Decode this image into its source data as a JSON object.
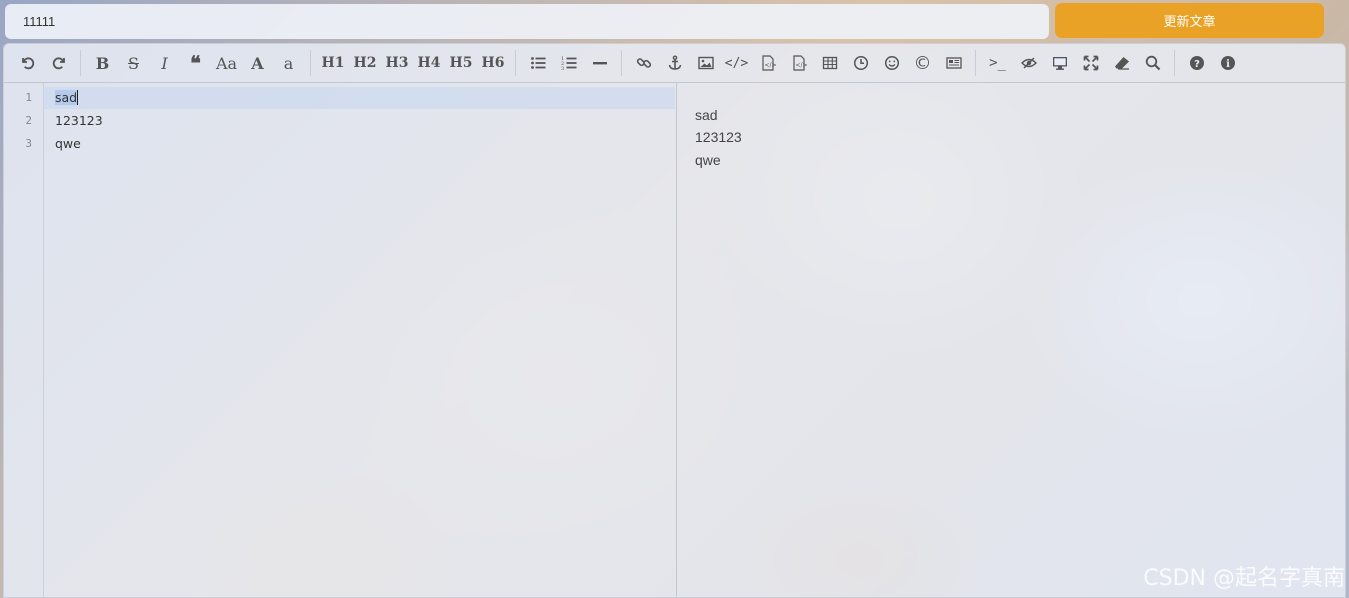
{
  "header": {
    "title_value": "11111",
    "update_button_label": "更新文章"
  },
  "toolbar": {
    "undo_icon": "undo-icon",
    "redo_icon": "redo-icon",
    "bold": "B",
    "strike": "S",
    "italic": "I",
    "quote": "❝",
    "case_upper": "Aa",
    "uppercase": "A",
    "lowercase": "a",
    "headings": [
      "H1",
      "H2",
      "H3",
      "H4",
      "H5",
      "H6"
    ],
    "list_ul": "≡",
    "list_ol": "⋮≡",
    "hr": "—",
    "info_circle": "❓",
    "info": "ℹ"
  },
  "editor": {
    "lines": [
      {
        "no": "1",
        "text": "sad"
      },
      {
        "no": "2",
        "text": "123123"
      },
      {
        "no": "3",
        "text": "qwe"
      }
    ]
  },
  "preview": {
    "lines": [
      "sad",
      "123123",
      "qwe"
    ]
  },
  "watermark": "CSDN @起名字真南",
  "colors": {
    "accent": "#e9a226",
    "toolbar_icon": "#555555"
  }
}
